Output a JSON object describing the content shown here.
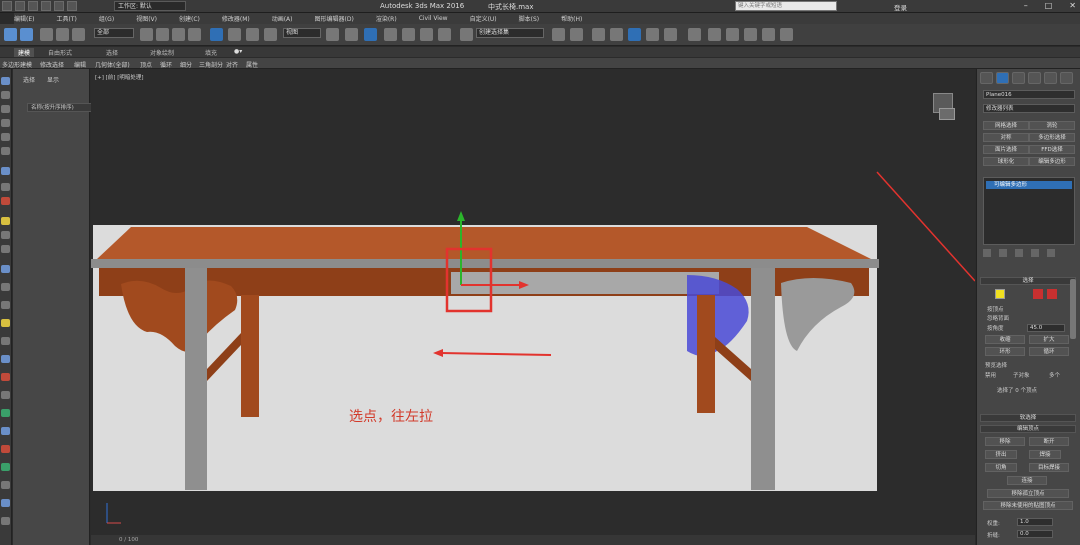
{
  "titlebar": {
    "workspace": "工作区: 默认",
    "app_title": "Autodesk 3ds Max 2016",
    "file_name": "中式长椅.max",
    "search_placeholder": "键入关键字或短语",
    "login": "登录"
  },
  "menu": {
    "items": [
      "编辑(E)",
      "工具(T)",
      "组(G)",
      "视图(V)",
      "创建(C)",
      "修改器(M)",
      "动画(A)",
      "图形编辑器(D)",
      "渲染(R)",
      "Civil View",
      "自定义(U)",
      "脚本(S)",
      "帮助(H)"
    ]
  },
  "toolbar": {
    "selection_filter": "全部",
    "ref_coord": "视图",
    "named_selection": "创建选择集"
  },
  "ribbon": {
    "tabs": [
      "建模",
      "自由形式",
      "选择",
      "对象绘制",
      "填充"
    ],
    "active_tab": "建模",
    "row_items": [
      "多边形建模",
      "修改选择",
      "编辑",
      "几何体(全部)",
      "顶点",
      "循环",
      "细分",
      "三角剖分",
      "对齐",
      "属性"
    ]
  },
  "scene_explorer": {
    "tabs": [
      "选择",
      "显示"
    ],
    "column_header": "名称(按升序排序)",
    "footer": "0 / 100"
  },
  "viewport": {
    "label": "[+] [前] [明暗处理]",
    "annotation": "选点，往左拉",
    "colors": {
      "tabletop": "#b4582a",
      "wood": "#a14a1e",
      "frame": "#8a8a8a",
      "background": "#dcdcdc",
      "highlight": "#e2332e",
      "selection": "#4a4ad6"
    }
  },
  "command_panel": {
    "object_name": "Plane016",
    "modifier_list": "修改器列表",
    "buttons": [
      [
        "网格选择",
        "涡轮"
      ],
      [
        "对称",
        "多边形选择"
      ],
      [
        "面片选择",
        "FFD选择"
      ],
      [
        "球形化",
        "编辑多边形"
      ]
    ],
    "stack_item": "可编辑多边形",
    "selection_rollout": "选择",
    "by_vertex": "按顶点",
    "ignore_backfacing": "忽略背面",
    "by_angle": "按角度",
    "angle_value": "45.0",
    "shrink": "收缩",
    "grow": "扩大",
    "ring": "环形",
    "loop": "循环",
    "preview_selection": "预览选择",
    "preview_options": [
      "禁用",
      "子对象",
      "多个"
    ],
    "selected_count": "选择了 0 个顶点",
    "soft_selection": "软选择",
    "edit_vertices": "编辑顶点",
    "remove": "移除",
    "break": "断开",
    "extrude": "挤出",
    "weld": "焊接",
    "chamfer": "切角",
    "target_weld": "目标焊接",
    "connect": "连接",
    "remove_isolated": "移除孤立顶点",
    "remove_unused_map": "移除未使用的贴图顶点",
    "weight_label": "权重:",
    "weight_value": "1.0",
    "crease_label": "折缝:",
    "crease_value": "0.0"
  }
}
